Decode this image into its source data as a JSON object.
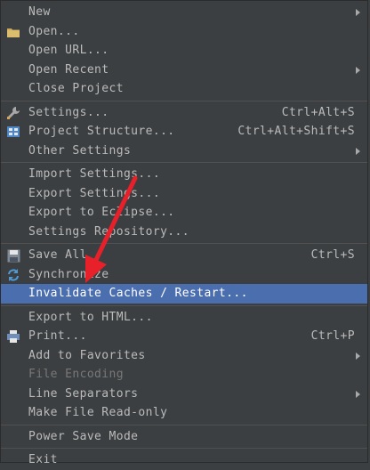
{
  "menu": {
    "items": [
      {
        "label": "New",
        "shortcut": "",
        "submenu": true,
        "icon": "",
        "state": "normal"
      },
      {
        "label": "Open...",
        "shortcut": "",
        "submenu": false,
        "icon": "folder-icon",
        "state": "normal"
      },
      {
        "label": "Open URL...",
        "shortcut": "",
        "submenu": false,
        "icon": "",
        "state": "normal"
      },
      {
        "label": "Open Recent",
        "shortcut": "",
        "submenu": true,
        "icon": "",
        "state": "normal"
      },
      {
        "label": "Close Project",
        "shortcut": "",
        "submenu": false,
        "icon": "",
        "state": "normal"
      },
      {
        "label": "Settings...",
        "shortcut": "Ctrl+Alt+S",
        "submenu": false,
        "icon": "wrench-icon",
        "state": "normal"
      },
      {
        "label": "Project Structure...",
        "shortcut": "Ctrl+Alt+Shift+S",
        "submenu": false,
        "icon": "project-structure-icon",
        "state": "normal"
      },
      {
        "label": "Other Settings",
        "shortcut": "",
        "submenu": true,
        "icon": "",
        "state": "normal"
      },
      {
        "label": "Import Settings...",
        "shortcut": "",
        "submenu": false,
        "icon": "",
        "state": "normal"
      },
      {
        "label": "Export Settings...",
        "shortcut": "",
        "submenu": false,
        "icon": "",
        "state": "normal"
      },
      {
        "label": "Export to Eclipse...",
        "shortcut": "",
        "submenu": false,
        "icon": "",
        "state": "normal"
      },
      {
        "label": "Settings Repository...",
        "shortcut": "",
        "submenu": false,
        "icon": "",
        "state": "normal"
      },
      {
        "label": "Save All",
        "shortcut": "Ctrl+S",
        "submenu": false,
        "icon": "save-icon",
        "state": "normal"
      },
      {
        "label": "Synchronize",
        "shortcut": "",
        "submenu": false,
        "icon": "sync-icon",
        "state": "normal"
      },
      {
        "label": "Invalidate Caches / Restart...",
        "shortcut": "",
        "submenu": false,
        "icon": "",
        "state": "selected"
      },
      {
        "label": "Export to HTML...",
        "shortcut": "",
        "submenu": false,
        "icon": "",
        "state": "normal"
      },
      {
        "label": "Print...",
        "shortcut": "Ctrl+P",
        "submenu": false,
        "icon": "printer-icon",
        "state": "normal"
      },
      {
        "label": "Add to Favorites",
        "shortcut": "",
        "submenu": true,
        "icon": "",
        "state": "normal"
      },
      {
        "label": "File Encoding",
        "shortcut": "",
        "submenu": false,
        "icon": "",
        "state": "disabled"
      },
      {
        "label": "Line Separators",
        "shortcut": "",
        "submenu": true,
        "icon": "",
        "state": "normal"
      },
      {
        "label": "Make File Read-only",
        "shortcut": "",
        "submenu": false,
        "icon": "",
        "state": "normal"
      },
      {
        "label": "Power Save Mode",
        "shortcut": "",
        "submenu": false,
        "icon": "",
        "state": "normal"
      },
      {
        "label": "Exit",
        "shortcut": "",
        "submenu": false,
        "icon": "",
        "state": "normal"
      }
    ],
    "separators_after": [
      4,
      7,
      11,
      14,
      20,
      21
    ]
  },
  "colors": {
    "menu_background": "#3c3f41",
    "text": "#bbbbbb",
    "selected_background": "#4b6eaf",
    "disabled_text": "#787878",
    "annotation_arrow": "#e8202a"
  }
}
